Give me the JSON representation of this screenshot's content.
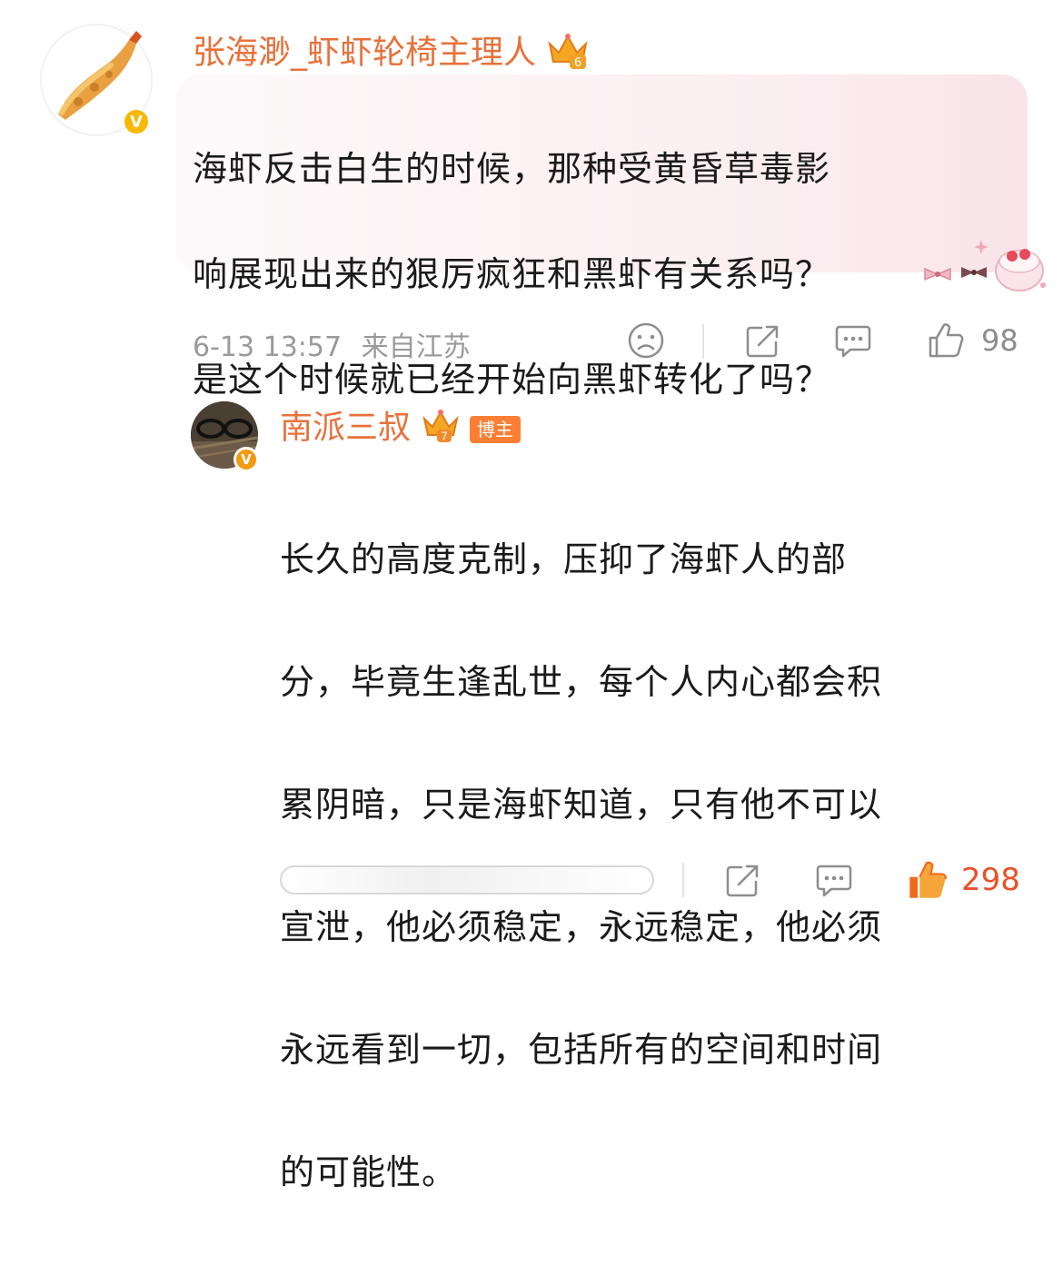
{
  "comment": {
    "username": "张海渺_虾虾轮椅主理人",
    "level": "6",
    "verified_mark": "V",
    "avatar_icon": "fried-shrimp-icon",
    "lines": [
      "海虾反击白生的时候，那种受黄昏草毒影",
      "响展现出来的狠厉疯狂和黑虾有关系吗？",
      "是这个时候就已经开始向黑虾转化了吗？"
    ],
    "timestamp": "6-13 13:57",
    "location": "来自江苏",
    "likes": "98"
  },
  "reply": {
    "username": "南派三叔",
    "level": "7",
    "badge": "博主",
    "verified_mark": "V",
    "avatar_icon": "glasses-photo-avatar",
    "lines": [
      "长久的高度克制，压抑了海虾人的部",
      "分，毕竟生逢乱世，每个人内心都会积",
      "累阴暗，只是海虾知道，只有他不可以",
      "宣泄，他必须稳定，永远稳定，他必须",
      "永远看到一切，包括所有的空间和时间",
      "的可能性。"
    ],
    "likes": "298"
  },
  "colors": {
    "username": "#e8713a",
    "like_active": "#e8512a",
    "verified_gold": "#f7b800",
    "blogger_tag": "#fa7f34"
  }
}
